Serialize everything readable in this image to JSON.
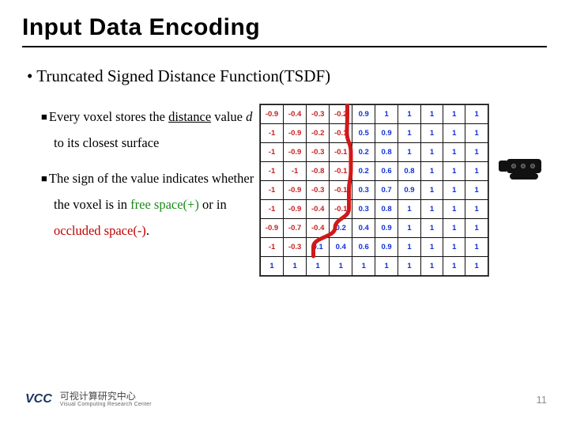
{
  "title": "Input Data Encoding",
  "bullet_main": "Truncated Signed Distance Function(TSDF)",
  "sub1": {
    "lead": "Every voxel stores the ",
    "underline": "distance",
    "mid": " value ",
    "var": "d",
    "tail": " to its closest surface"
  },
  "sub2": {
    "lead": "The sign of the value indicates whether the voxel is in ",
    "free_label": "free space(+)",
    "mid": " or in ",
    "occ_label": "occluded space(-)",
    "tail": "."
  },
  "grid": [
    [
      "-0.9",
      "-0.4",
      "-0.3",
      "-0.2",
      "0.9",
      "1",
      "1",
      "1",
      "1",
      "1"
    ],
    [
      "-1",
      "-0.9",
      "-0.2",
      "-0.1",
      "0.5",
      "0.9",
      "1",
      "1",
      "1",
      "1"
    ],
    [
      "-1",
      "-0.9",
      "-0.3",
      "-0.1",
      "0.2",
      "0.8",
      "1",
      "1",
      "1",
      "1"
    ],
    [
      "-1",
      "-1",
      "-0.8",
      "-0.1",
      "0.2",
      "0.6",
      "0.8",
      "1",
      "1",
      "1"
    ],
    [
      "-1",
      "-0.9",
      "-0.3",
      "-0.1",
      "0.3",
      "0.7",
      "0.9",
      "1",
      "1",
      "1"
    ],
    [
      "-1",
      "-0.9",
      "-0.4",
      "-0.1",
      "0.3",
      "0.8",
      "1",
      "1",
      "1",
      "1"
    ],
    [
      "-0.9",
      "-0.7",
      "-0.4",
      "0.2",
      "0.4",
      "0.9",
      "1",
      "1",
      "1",
      "1"
    ],
    [
      "-1",
      "-0.3",
      "0.1",
      "0.4",
      "0.6",
      "0.9",
      "1",
      "1",
      "1",
      "1"
    ],
    [
      "1",
      "1",
      "1",
      "1",
      "1",
      "1",
      "1",
      "1",
      "1",
      "1"
    ]
  ],
  "footer": {
    "logo_text": "VCC",
    "cn": "可视计算研究中心",
    "en": "Visual Computing Research Center"
  },
  "page_number": "11"
}
